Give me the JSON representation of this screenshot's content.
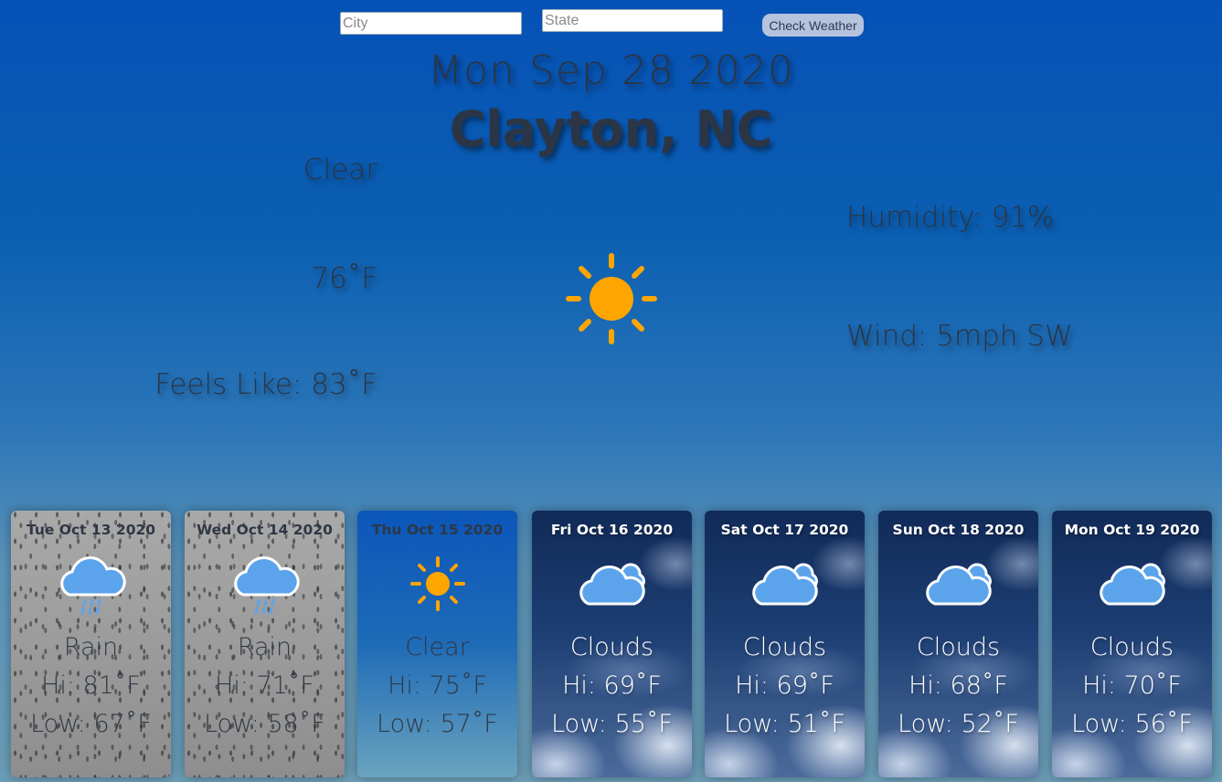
{
  "search": {
    "city_placeholder": "City",
    "state_placeholder": "State",
    "button_label": "Check Weather"
  },
  "current": {
    "date": "Mon Sep 28 2020",
    "location": "Clayton, NC",
    "condition": "Clear",
    "temperature": "76˚F",
    "feels_like": "Feels Like: 83˚F",
    "humidity": "Humidity: 91%",
    "wind": "Wind: 5mph SW",
    "icon": "sun-icon"
  },
  "forecast": [
    {
      "date": "Tue Oct 13 2020",
      "condition": "Rain",
      "hi": "Hi: 81˚F",
      "low": "Low: 67˚F",
      "icon": "rain-cloud-icon"
    },
    {
      "date": "Wed Oct 14 2020",
      "condition": "Rain",
      "hi": "Hi: 71˚F",
      "low": "Low: 58˚F",
      "icon": "rain-cloud-icon"
    },
    {
      "date": "Thu Oct 15 2020",
      "condition": "Clear",
      "hi": "Hi: 75˚F",
      "low": "Low: 57˚F",
      "icon": "sun-icon"
    },
    {
      "date": "Fri Oct 16 2020",
      "condition": "Clouds",
      "hi": "Hi: 69˚F",
      "low": "Low: 55˚F",
      "icon": "cloud-icon"
    },
    {
      "date": "Sat Oct 17 2020",
      "condition": "Clouds",
      "hi": "Hi: 69˚F",
      "low": "Low: 51˚F",
      "icon": "cloud-icon"
    },
    {
      "date": "Sun Oct 18 2020",
      "condition": "Clouds",
      "hi": "Hi: 68˚F",
      "low": "Low: 52˚F",
      "icon": "cloud-icon"
    },
    {
      "date": "Mon Oct 19 2020",
      "condition": "Clouds",
      "hi": "Hi: 70˚F",
      "low": "Low: 56˚F",
      "icon": "cloud-icon"
    }
  ],
  "colors": {
    "sun": "#ffa500",
    "cloud_fill": "#5ba4ec",
    "rain_drop": "#5ba4ec",
    "button_bg": "#b6c3dd"
  }
}
